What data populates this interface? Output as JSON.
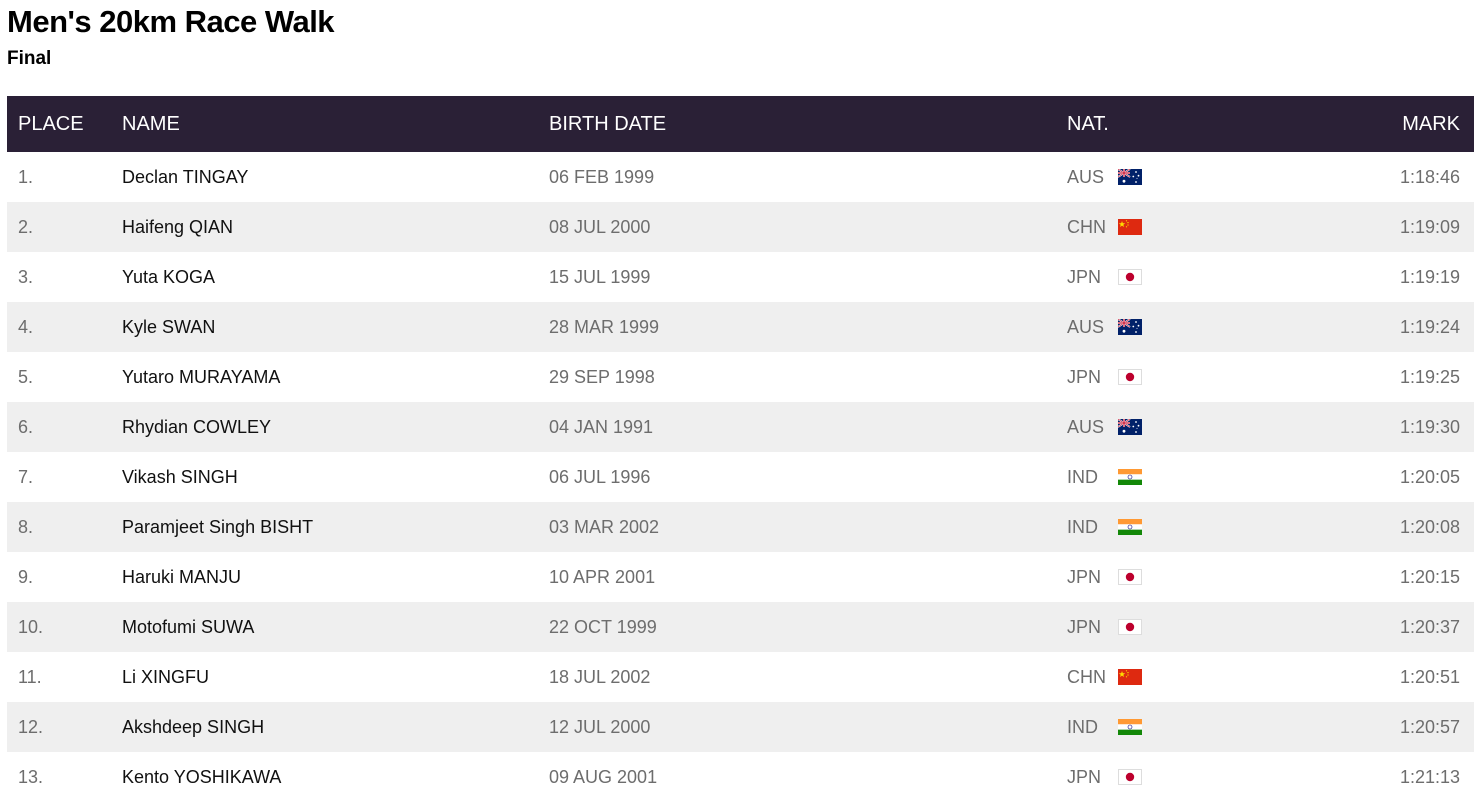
{
  "page": {
    "title": "Men's 20km Race Walk",
    "subtitle": "Final"
  },
  "table": {
    "headers": {
      "place": "PLACE",
      "name": "NAME",
      "birth_date": "BIRTH DATE",
      "nat": "NAT.",
      "mark": "MARK"
    },
    "rows": [
      {
        "place": "1.",
        "name": "Declan TINGAY",
        "birth_date": "06 FEB 1999",
        "nat": "AUS",
        "flag": "australia-flag-icon",
        "mark": "1:18:46"
      },
      {
        "place": "2.",
        "name": "Haifeng QIAN",
        "birth_date": "08 JUL 2000",
        "nat": "CHN",
        "flag": "china-flag-icon",
        "mark": "1:19:09"
      },
      {
        "place": "3.",
        "name": "Yuta KOGA",
        "birth_date": "15 JUL 1999",
        "nat": "JPN",
        "flag": "japan-flag-icon",
        "mark": "1:19:19"
      },
      {
        "place": "4.",
        "name": "Kyle SWAN",
        "birth_date": "28 MAR 1999",
        "nat": "AUS",
        "flag": "australia-flag-icon",
        "mark": "1:19:24"
      },
      {
        "place": "5.",
        "name": "Yutaro MURAYAMA",
        "birth_date": "29 SEP 1998",
        "nat": "JPN",
        "flag": "japan-flag-icon",
        "mark": "1:19:25"
      },
      {
        "place": "6.",
        "name": "Rhydian COWLEY",
        "birth_date": "04 JAN 1991",
        "nat": "AUS",
        "flag": "australia-flag-icon",
        "mark": "1:19:30"
      },
      {
        "place": "7.",
        "name": "Vikash SINGH",
        "birth_date": "06 JUL 1996",
        "nat": "IND",
        "flag": "india-flag-icon",
        "mark": "1:20:05"
      },
      {
        "place": "8.",
        "name": "Paramjeet Singh BISHT",
        "birth_date": "03 MAR 2002",
        "nat": "IND",
        "flag": "india-flag-icon",
        "mark": "1:20:08"
      },
      {
        "place": "9.",
        "name": "Haruki MANJU",
        "birth_date": "10 APR 2001",
        "nat": "JPN",
        "flag": "japan-flag-icon",
        "mark": "1:20:15"
      },
      {
        "place": "10.",
        "name": "Motofumi SUWA",
        "birth_date": "22 OCT 1999",
        "nat": "JPN",
        "flag": "japan-flag-icon",
        "mark": "1:20:37"
      },
      {
        "place": "11.",
        "name": "Li XINGFU",
        "birth_date": "18 JUL 2002",
        "nat": "CHN",
        "flag": "china-flag-icon",
        "mark": "1:20:51"
      },
      {
        "place": "12.",
        "name": "Akshdeep SINGH",
        "birth_date": "12 JUL 2000",
        "nat": "IND",
        "flag": "india-flag-icon",
        "mark": "1:20:57"
      },
      {
        "place": "13.",
        "name": "Kento YOSHIKAWA",
        "birth_date": "09 AUG 2001",
        "nat": "JPN",
        "flag": "japan-flag-icon",
        "mark": "1:21:13"
      }
    ]
  },
  "colors": {
    "header_background": "#2a2036",
    "header_text": "#ffffff",
    "zebra_row": "#efefef",
    "muted_text": "#6d6d6d"
  }
}
